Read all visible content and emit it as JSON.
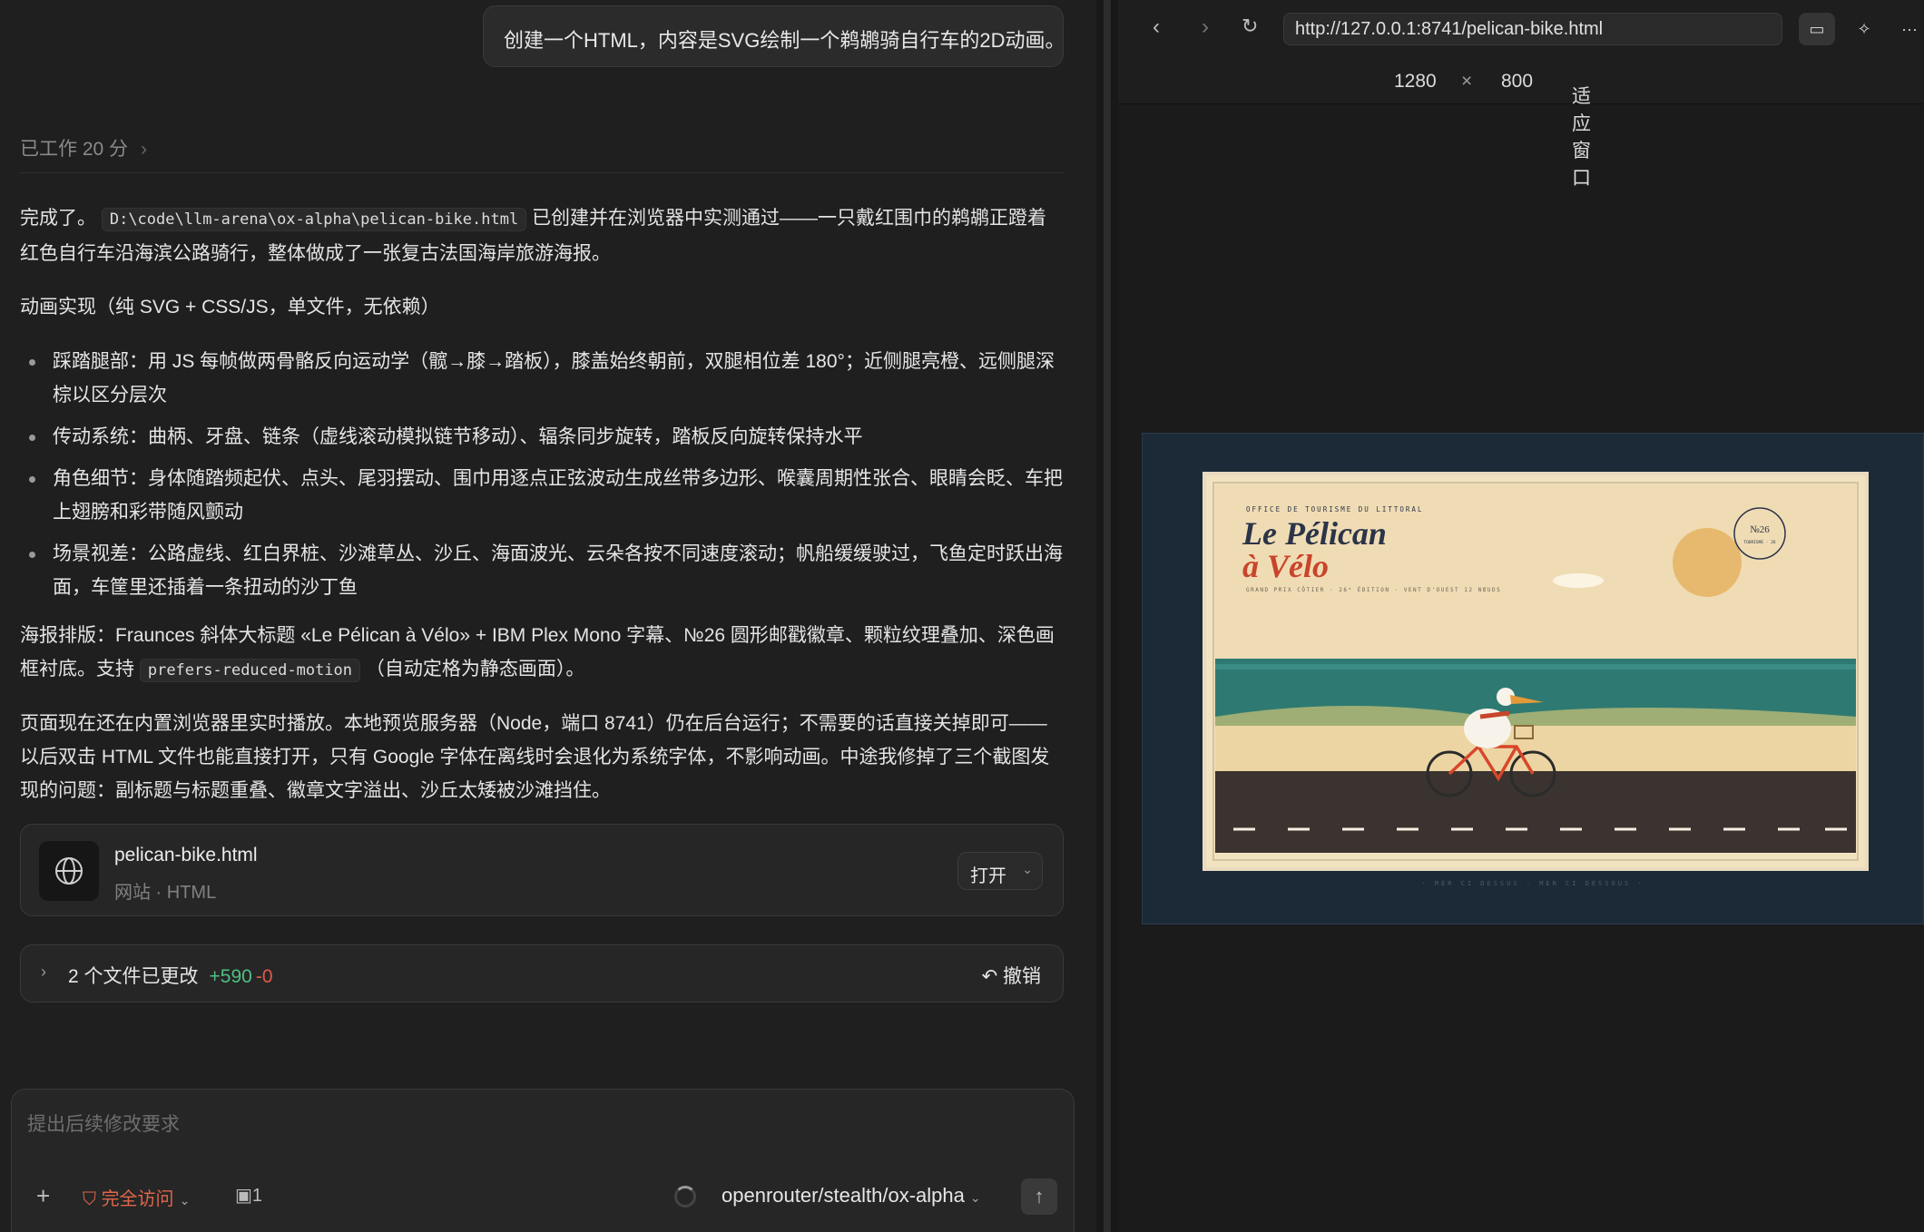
{
  "chat": {
    "user_message": "创建一个HTML，内容是SVG绘制一个鹈鹕骑自行车的2D动画。",
    "worked_label": "已工作 20 分",
    "para1_before": "完成了。",
    "file_path": "D:\\code\\llm-arena\\ox-alpha\\pelican-bike.html",
    "para1_after": "已创建并在浏览器中实测通过——一只戴红围巾的鹈鹕正蹬着红色自行车沿海滨公路骑行，整体做成了一张复古法国海岸旅游海报。",
    "para2": "动画实现（纯 SVG + CSS/JS，单文件，无依赖）",
    "bullets": [
      "踩踏腿部：用 JS 每帧做两骨骼反向运动学（髋→膝→踏板），膝盖始终朝前，双腿相位差 180°；近侧腿亮橙、远侧腿深棕以区分层次",
      "传动系统：曲柄、牙盘、链条（虚线滚动模拟链节移动）、辐条同步旋转，踏板反向旋转保持水平",
      "角色细节：身体随踏频起伏、点头、尾羽摆动、围巾用逐点正弦波动生成丝带多边形、喉囊周期性张合、眼睛会眨、车把上翅膀和彩带随风颤动",
      "场景视差：公路虚线、红白界桩、沙滩草丛、沙丘、海面波光、云朵各按不同速度滚动；帆船缓缓驶过，飞鱼定时跃出海面，车筐里还插着一条扭动的沙丁鱼"
    ],
    "para3_before": "海报排版：Fraunces 斜体大标题 «Le Pélican à Vélo» + IBM Plex Mono 字幕、№26 圆形邮戳徽章、颗粒纹理叠加、深色画框衬底。支持",
    "reduced_motion_code": "prefers-reduced-motion",
    "para3_after": "（自动定格为静态画面）。",
    "para4": "页面现在还在内置浏览器里实时播放。本地预览服务器（Node，端口 8741）仍在后台运行；不需要的话直接关掉即可——以后双击 HTML 文件也能直接打开，只有 Google 字体在离线时会退化为系统字体，不影响动画。中途我修掉了三个截图发现的问题：副标题与标题重叠、徽章文字溢出、沙丘太矮被沙滩挡住。",
    "file_card": {
      "name": "pelican-bike.html",
      "sub": "网站 · HTML",
      "open_label": "打开"
    },
    "changes": {
      "label": "2 个文件已更改",
      "added": "+590",
      "removed": "-0",
      "undo_label": "撤销"
    }
  },
  "composer": {
    "placeholder": "提出后续修改要求",
    "access_label": "完全访问",
    "task_count": "1",
    "model": "openrouter/stealth/ox-alpha"
  },
  "browser": {
    "url": "http://127.0.0.1:8741/pelican-bike.html",
    "width": "1280",
    "times": "×",
    "height": "800",
    "fit_label": "适应窗口"
  },
  "poster": {
    "office": "OFFICE DE TOURISME DU LITTORAL",
    "title_line1": "Le Pélican",
    "title_line2": "à Vélo",
    "subtitle": "GRAND PRIX CÔTIER · 26ᵉ ÉDITION · VENT D'OUEST 12 NŒUDS",
    "stamp_num": "№26",
    "stamp_sub": "TOURISME · 26",
    "footer": "· MER CI DESSUS · MER CI DESSOUS ·"
  },
  "colors": {
    "add": "#4fbf84",
    "remove": "#e0594a",
    "access": "#e0664a",
    "poster_bg": "#f3e3bf",
    "title": "#2b3448",
    "title_accent": "#c8452b"
  }
}
